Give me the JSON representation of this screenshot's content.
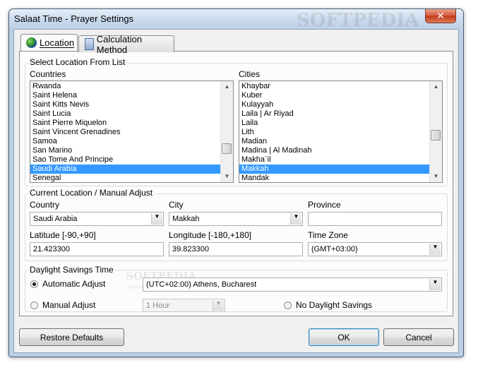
{
  "window": {
    "title": "Salaat Time - Prayer Settings",
    "close_glyph": "✕",
    "watermark": "SOFTPEDIA",
    "watermark_small": "www.softpedia.com"
  },
  "tabs": [
    {
      "label": "Location",
      "icon": "globe-icon",
      "active": true
    },
    {
      "label": "Calculation Method",
      "icon": "calculator-icon",
      "active": false
    }
  ],
  "select_location": {
    "title": "Select Location From List",
    "countries_label": "Countries",
    "countries": [
      "Rwanda",
      "Saint Helena",
      "Saint Kitts Nevis",
      "Saint Lucia",
      "Saint Pierre Miquelon",
      "Saint Vincent Grenadines",
      "Samoa",
      "San Marino",
      "Sao Tome And Principe",
      "Saudi Arabia",
      "Senegal"
    ],
    "countries_selected": "Saudi Arabia",
    "cities_label": "Cities",
    "cities": [
      "Khaybar",
      "Kuber",
      "Kulayyah",
      "Laila | Ar Riyad",
      "Laila",
      "Lith",
      "Madian",
      "Madina | Al Madinah",
      "Makha`il",
      "Makkah",
      "Mandak"
    ],
    "cities_selected": "Makkah"
  },
  "current_location": {
    "title": "Current Location / Manual Adjust",
    "country_label": "Country",
    "country_value": "Saudi Arabia",
    "city_label": "City",
    "city_value": "Makkah",
    "province_label": "Province",
    "province_value": "",
    "latitude_label": "Latitude [-90,+90]",
    "latitude_value": "21.423300",
    "longitude_label": "Longitude [-180,+180]",
    "longitude_value": "39.823300",
    "timezone_label": "Time Zone",
    "timezone_value": "(GMT+03:00)"
  },
  "daylight": {
    "title": "Daylight Savings Time",
    "automatic_label": "Automatic Adjust",
    "automatic_value": "(UTC+02:00) Athens, Bucharest",
    "manual_label": "Manual Adjust",
    "manual_value": "1 Hour",
    "none_label": "No Daylight Savings",
    "selected": "automatic"
  },
  "buttons": {
    "restore": "Restore Defaults",
    "ok": "OK",
    "cancel": "Cancel"
  },
  "colors": {
    "selection": "#3399ff",
    "window_frame": "#bcd0e6",
    "close_button": "#c94a2e"
  }
}
